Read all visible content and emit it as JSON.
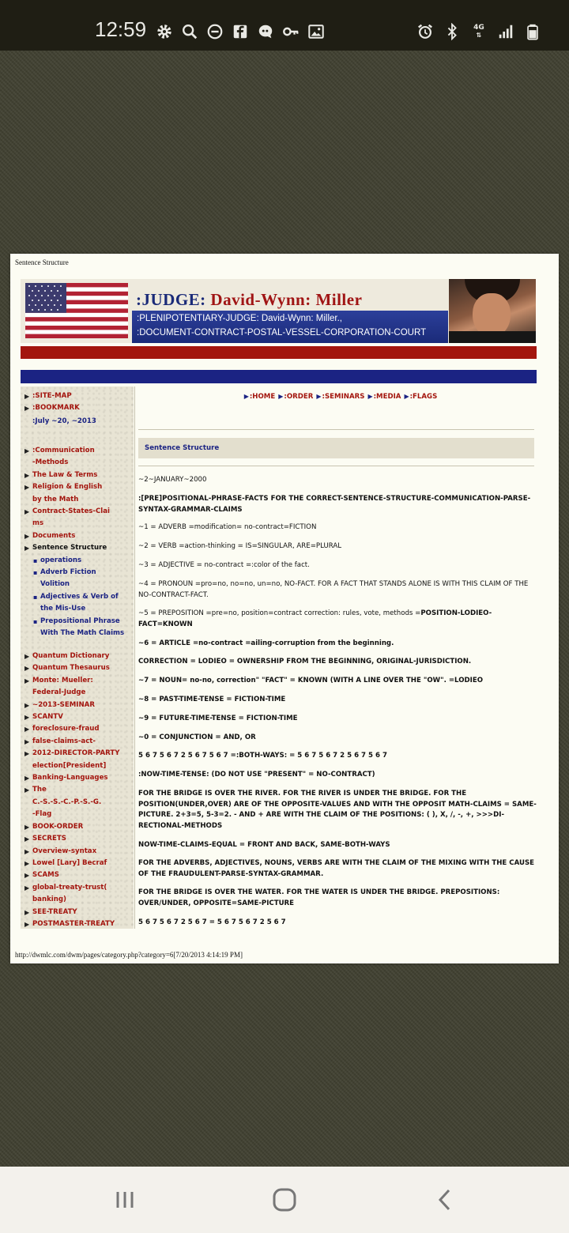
{
  "status_bar": {
    "time": "12:59",
    "left_icons": [
      "gear-icon",
      "search-icon",
      "do-not-disturb-icon",
      "facebook-icon",
      "chat-icon",
      "key-icon",
      "image-icon"
    ],
    "right_icons": [
      "alarm-icon",
      "bluetooth-icon",
      "4g-lte-icon",
      "signal-icon",
      "battery-icon"
    ],
    "network_label": "4G"
  },
  "page": {
    "title": "Sentence Structure",
    "url_footer": "http://dwmlc.com/dwm/pages/category.php?category=6[7/20/2013 4:14:19 PM]"
  },
  "banner": {
    "judge_prefix": ":JUDGE: ",
    "name_part1": "David-",
    "name_part2": "Wynn: ",
    "name_part3": "Miller",
    "line1": ":PLENIPOTENTIARY-JUDGE: David-Wynn: Miller.,",
    "line2": ":DOCUMENT-CONTRACT-POSTAL-VESSEL-CORPORATION-COURT"
  },
  "top_nav": [
    ":HOME",
    ":ORDER",
    ":SEMINARS",
    ":MEDIA",
    ":FLAGS"
  ],
  "sidebar": {
    "group1": [
      {
        "label": ":SITE-MAP",
        "color": "red"
      },
      {
        "label": ":BOOKMARK",
        "color": "red"
      }
    ],
    "date": ":July ~20, ~2013",
    "group2": [
      {
        "lines": [
          ":Communication",
          "-Methods"
        ],
        "color": "red"
      },
      {
        "lines": [
          "The Law & Terms"
        ],
        "color": "red"
      },
      {
        "lines": [
          "Religion & English",
          "by the Math"
        ],
        "color": "red"
      },
      {
        "lines": [
          "Contract-States-Clai",
          "ms"
        ],
        "color": "red"
      },
      {
        "lines": [
          "Documents"
        ],
        "color": "red"
      },
      {
        "lines": [
          "Sentence Structure"
        ],
        "color": "black"
      }
    ],
    "subitems": [
      {
        "lines": [
          "operations"
        ]
      },
      {
        "lines": [
          "Adverb Fiction",
          "Volition"
        ]
      },
      {
        "lines": [
          "Adjectives & Verb of",
          "the Mis-Use"
        ]
      },
      {
        "lines": [
          "Prepositional Phrase",
          "With The Math Claims"
        ]
      }
    ],
    "group3": [
      {
        "lines": [
          "Quantum Dictionary"
        ]
      },
      {
        "lines": [
          "Quantum Thesaurus"
        ]
      },
      {
        "lines": [
          "Monte: Mueller:",
          "Federal-Judge"
        ]
      },
      {
        "lines": [
          "~2013-SEMINAR"
        ]
      },
      {
        "lines": [
          "SCANTV"
        ]
      },
      {
        "lines": [
          "foreclosure-fraud"
        ]
      },
      {
        "lines": [
          "false-claims-act-"
        ]
      },
      {
        "lines": [
          "2012-DIRECTOR-PARTY",
          "election[President]"
        ]
      },
      {
        "lines": [
          "Banking-Languages"
        ]
      },
      {
        "lines": [
          "The",
          "C.-S.-S.-C.-P.-S.-G.",
          "-Flag"
        ]
      },
      {
        "lines": [
          "BOOK-ORDER"
        ]
      },
      {
        "lines": [
          "SECRETS"
        ]
      },
      {
        "lines": [
          "Overview-syntax"
        ]
      },
      {
        "lines": [
          "Lowel [Lary] Becraf"
        ]
      },
      {
        "lines": [
          "SCAMS"
        ]
      },
      {
        "lines": [
          "global-treaty-trust(",
          "banking)"
        ]
      },
      {
        "lines": [
          "SEE-TREATY"
        ]
      },
      {
        "lines": [
          "POSTMASTER-TREATY"
        ]
      }
    ]
  },
  "section_title": "Sentence Structure",
  "content": {
    "date": "~2~JANUARY~2000",
    "p1": ":[PRE]POSITIONAL-PHRASE-FACTS FOR THE CORRECT-SENTENCE-STRUCTURE-COMMUNICATION-PARSE-SYNTAX-GRAMMAR-CLAIMS",
    "p2": "~1 = ADVERB =modification= no-contract=FICTION",
    "p3": "~2 = VERB =action-thinking = IS=SINGULAR, ARE=PLURAL",
    "p4": "~3 = ADJECTIVE = no-contract =:color of the fact.",
    "p5": "~4 = PRONOUN =pro=no, no=no, un=no, NO-FACT. FOR A FACT THAT STANDS ALONE IS WITH THIS CLAIM OF THE NO-CONTRACT-FACT.",
    "p6a": "~5 = PREPOSITION =pre=no, position=contract correction: rules, vote, methods =",
    "p6b": "POSITION-LODIEO-FACT=KNOWN",
    "p7": "~6 = ARTICLE =no-contract =ailing-corruption from the beginning.",
    "p8": "CORRECTION = LODIEO = OWNERSHIP FROM THE BEGINNING, ORIGINAL-JURISDICTION.",
    "p9": "~7 = NOUN= no-no, correction\" \"FACT\" = KNOWN (WITH A LINE OVER THE \"OW\". =LODIEO",
    "p10": "~8 = PAST-TIME-TENSE = FICTION-TIME",
    "p11": "~9 = FUTURE-TIME-TENSE = FICTION-TIME",
    "p12": "~0 = CONJUNCTION = AND, OR",
    "p13": "5 6 7 5 6 7 2 5 6 7 5 6 7 =:BOTH-WAYS: = 5 6 7 5 6 7 2 5 6 7 5 6 7",
    "p14": ":NOW-TIME-TENSE: (DO NOT USE \"PRESENT\" = NO-CONTRACT)",
    "p15": "FOR THE BRIDGE IS OVER THE RIVER. FOR THE RIVER IS UNDER THE BRIDGE. FOR THE POSITION(UNDER,OVER) ARE OF THE OPPOSITE-VALUES AND WITH THE OPPOSIT MATH-CLAIMS = SAME-PICTURE. 2+3=5, 5-3=2. - AND + ARE WITH THE CLAIM OF THE POSITIONS: ( ), X, /, -, +, >>>DI-RECTIONAL-METHODS",
    "p16": "NOW-TIME-CLAIMS-EQUAL = FRONT AND BACK, SAME-BOTH-WAYS",
    "p17": "FOR THE ADVERBS, ADJECTIVES, NOUNS, VERBS ARE WITH THE CLAIM OF THE MIXING WITH THE CAUSE OF THE FRAUDULENT-PARSE-SYNTAX-GRAMMAR.",
    "p18": "FOR THE BRIDGE IS OVER THE WATER. FOR THE WATER IS UNDER THE BRIDGE. PREPOSITIONS: OVER/UNDER, OPPOSITE=SAME-PICTURE",
    "p19": "5 6 7 5 6 7 2 5 6 7 = 5 6 7 5 6 7 2 5 6 7"
  },
  "nav_bar": [
    "recent-apps-icon",
    "home-icon",
    "back-icon"
  ]
}
